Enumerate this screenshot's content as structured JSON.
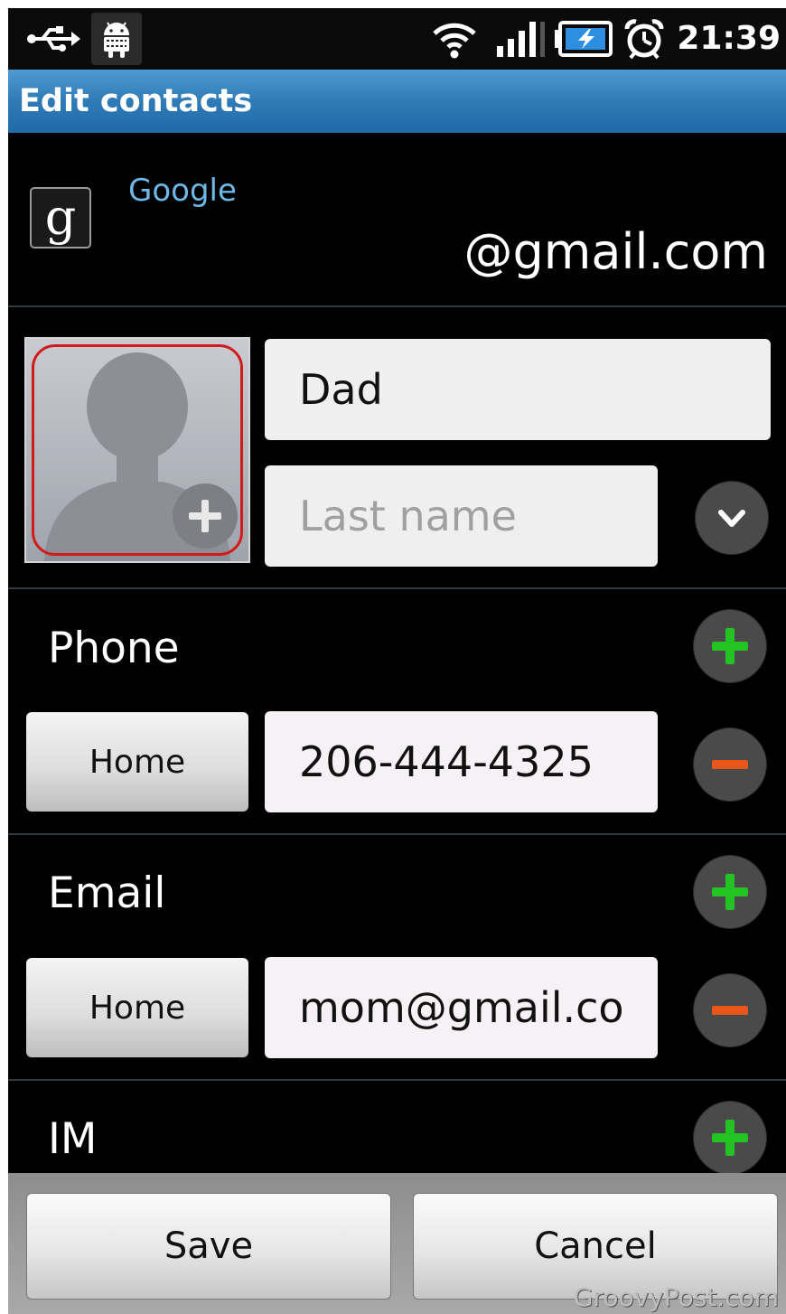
{
  "status_bar": {
    "time": "21:39",
    "icons": [
      "usb-icon",
      "android-debug-icon",
      "wifi-icon",
      "signal-icon",
      "battery-charging-icon",
      "alarm-icon"
    ]
  },
  "title_bar": {
    "title": "Edit contacts"
  },
  "account": {
    "icon_letter": "g",
    "type": "Google",
    "email": "@gmail.com",
    "icon": "google-g-icon"
  },
  "name": {
    "first_name": "Dad",
    "last_name_placeholder": "Last name",
    "photo_icon": "contact-photo-placeholder",
    "add_photo_icon": "plus-icon",
    "expand_icon": "chevron-down-icon"
  },
  "phone": {
    "label": "Phone",
    "type": "Home",
    "value": "206-444-4325"
  },
  "email": {
    "label": "Email",
    "type": "Home",
    "value": "mom@gmail.co"
  },
  "im": {
    "label": "IM"
  },
  "actions": {
    "save_label": "Save",
    "cancel_label": "Cancel"
  },
  "watermark": "GroovyPost.com",
  "colors": {
    "title_bar": "#2f7bb7",
    "account_type": "#6db8e6",
    "add": "#22c322",
    "remove": "#e8561a",
    "photo_ring": "#d21a1a"
  }
}
